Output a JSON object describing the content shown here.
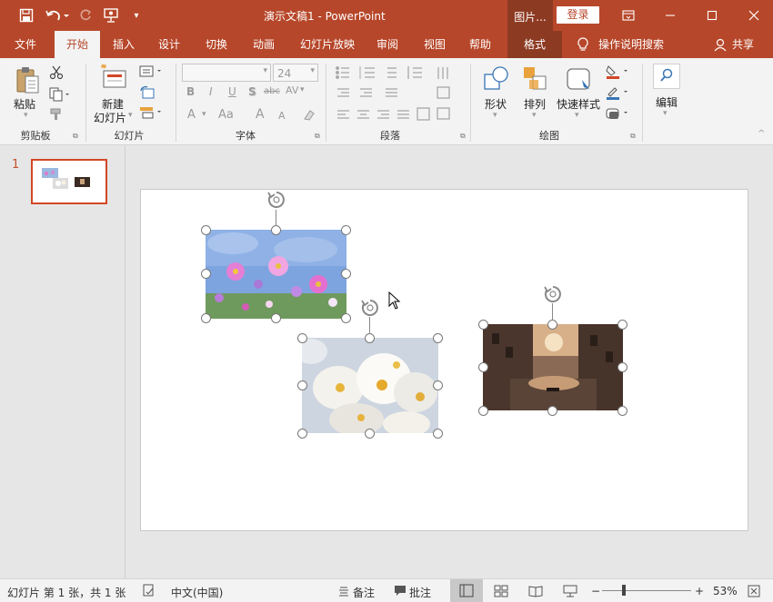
{
  "titlebar": {
    "title": "演示文稿1  -  PowerPoint",
    "picture_tools": "图片...",
    "login": "登录"
  },
  "tabs": [
    {
      "label": "文件"
    },
    {
      "label": "开始"
    },
    {
      "label": "插入"
    },
    {
      "label": "设计"
    },
    {
      "label": "切换"
    },
    {
      "label": "动画"
    },
    {
      "label": "幻灯片放映"
    },
    {
      "label": "审阅"
    },
    {
      "label": "视图"
    },
    {
      "label": "帮助"
    },
    {
      "label": "格式"
    }
  ],
  "tell_me": "操作说明搜索",
  "share": "共享",
  "ribbon": {
    "clipboard": {
      "label": "剪贴板",
      "paste": "粘贴"
    },
    "slides": {
      "label": "幻灯片",
      "new_slide_1": "新建",
      "new_slide_2": "幻灯片"
    },
    "font": {
      "label": "字体",
      "font_name": "",
      "font_size": "24",
      "bold": "B",
      "italic": "I",
      "underline": "U",
      "shadow": "S",
      "strike": "abc",
      "spacing": "AV",
      "fontcolor": "A",
      "grow": "A",
      "shrink": "A"
    },
    "paragraph": {
      "label": "段落"
    },
    "drawing": {
      "label": "绘图",
      "shapes": "形状",
      "arrange": "排列",
      "quick_styles": "快速样式"
    },
    "editing": {
      "label": "编辑",
      "edit": "编辑"
    }
  },
  "thumbnails": {
    "slide_number": "1"
  },
  "statusbar": {
    "slide_info": "幻灯片 第 1 张，共 1 张",
    "language": "中文(中国)",
    "notes": "备注",
    "comments": "批注",
    "zoom": "53%"
  },
  "colors": {
    "accent": "#b7472a",
    "accent_dark": "#8d3a22",
    "ribbon_bg": "#f3f3f3",
    "selection_border": "#d24726"
  }
}
